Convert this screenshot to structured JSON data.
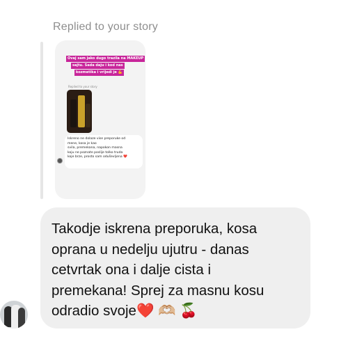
{
  "reply": {
    "label": "Replied to your story"
  },
  "story": {
    "banner_lines": [
      "Ovaj sam jako dugo trazila na MAKEUP",
      "sajtu. Sada daju i kod nas",
      "kozmetika i vrijedi je 💪"
    ],
    "inner_mini_label": "Replied to your story",
    "inner_message_lines": [
      "Iskreno ne dolaze vise preporuke od",
      "mene, kosa je kao",
      "svila, premekana, napokon masna",
      "koju ne poznate poslije tolko truda",
      "koje brze, prosto sam oduševljena ❤️"
    ]
  },
  "message": {
    "lines": [
      "Takodje iskrena preporuka, kosa",
      "oprana u nedelju ujutru - danas",
      "cetvrtak ona i dalje cista i",
      "premekana! Sprej za masnu kosu",
      "odradio svoje"
    ],
    "emoji_heart": "❤️",
    "emoji_hands": "🫶🏼",
    "emoji_cherry": "🍒"
  },
  "colors": {
    "bubble_bg": "#efefef",
    "story_banner": "#c8259a",
    "label_gray": "#8e8e8e"
  }
}
